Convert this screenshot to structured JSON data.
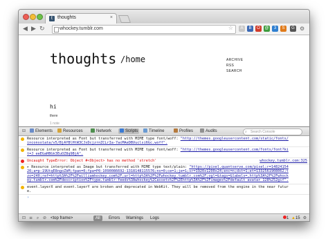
{
  "browser": {
    "tab_title": "thoughts",
    "tab_favicon": "t",
    "tab_close": "×",
    "url": "whockey.tumblr.com",
    "back_icon": "arrow-left-icon",
    "forward_icon": "arrow-right-icon",
    "reload_icon": "reload-icon",
    "home_icon": "home-icon",
    "extensions": [
      {
        "label": "A",
        "color": "#c8c8c8"
      },
      {
        "label": "B",
        "color": "#3a68b4"
      },
      {
        "label": "O",
        "color": "#d13b2a"
      },
      {
        "label": "@",
        "color": "#3d9b3d"
      },
      {
        "label": "3",
        "color": "#2f7fd0"
      },
      {
        "label": "S",
        "color": "#e07a1a"
      },
      {
        "label": "G",
        "color": "#555555"
      }
    ]
  },
  "page": {
    "title": "thoughts",
    "subtitle": "/home",
    "nav": [
      "ARCHIVE",
      "RSS",
      "SEARCH"
    ],
    "post_title": "hi",
    "post_body": "there",
    "post_more": "1 note"
  },
  "devtools": {
    "tabs": [
      {
        "label": "Elements",
        "color": "#6b8dc8"
      },
      {
        "label": "Resources",
        "color": "#d4a43a"
      },
      {
        "label": "Network",
        "color": "#4f8f4f"
      },
      {
        "label": "Scripts",
        "color": "#3b7bd3"
      },
      {
        "label": "Timeline",
        "color": "#6a9bd2"
      },
      {
        "label": "Profiles",
        "color": "#b57a3d"
      },
      {
        "label": "Audits",
        "color": "#909090"
      }
    ],
    "active_tab": "Scripts",
    "search_placeholder": "Search Console",
    "messages": [
      {
        "type": "warn",
        "text": "Resource interpreted as Font but transferred with MIME type font/woff: ",
        "link": "\"http://themes.googleusercontent.com/static/fonts/inconsolata/v5/BjAYBlHtW3CJxDcjzrnZCLrIa-7acMAeDBVuclsi6Gc.woff\".",
        "src": ""
      },
      {
        "type": "warn",
        "text": "Resource interpreted as Font but transferred with MIME type font/woff: ",
        "link": "\"http://themes.googleusercontent.com/fonts/font?kit=J_eeEGaHBGk3EuOZ8q9BjA\".",
        "src": ""
      },
      {
        "type": "err",
        "text": "Uncaught TypeError: Object #<Object> has no method 'stretch'",
        "link": "",
        "src": "whockey.tumblr.com:325"
      },
      {
        "type": "warn",
        "text": "▸ Resource interpreted as Image but transferred with MIME type text/plain: ",
        "link": "\"https://pixel.quantserve.com/pixel;r=1482415420;a=p-19UtqE8ngoZbM;fpan=0;fpa=P0-1090086692-1318148115576;ns=0;ce=1;je=1;sr=1920x1200x24;enc=n;dst=1;et=1332561908062;tzo=240;ref=http%3A%2F%2Fwilliamhockey.com%2F;url=http%3A%2F%2Fwhockey.tumblr.com%2F;ogl=&tags=&labels=,http%3A%2F%2Fwhockey.tumblr.com%2Fdescription%2Ftype.tumblr-feeds%3Awhockey%2Cassets%2F%2Ehttp%3A%2F%2Fimages%2Fdefault_avatar_128%252gif\".",
        "src": ""
      },
      {
        "type": "warn",
        "text": "event.layerX and event.layerY are broken and deprecated in WebKit. They will be removed from the engine in the near future.",
        "link": "",
        "src": ""
      }
    ],
    "prompt": "›",
    "status": {
      "frame": "<top frame>",
      "filters": [
        "All",
        "Errors",
        "Warnings",
        "Logs"
      ],
      "error_count": "1",
      "warning_count": "15"
    }
  }
}
